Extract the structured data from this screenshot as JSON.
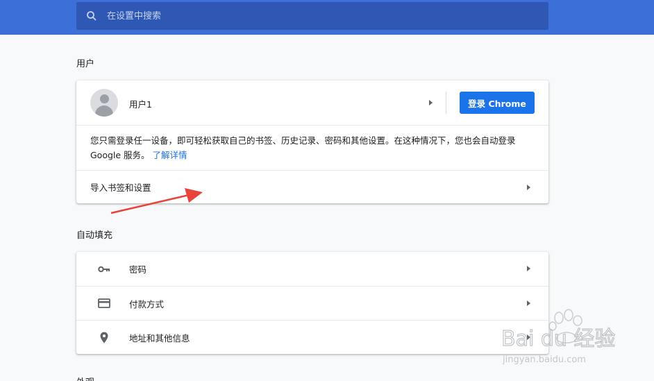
{
  "search": {
    "placeholder": "在设置中搜索"
  },
  "people": {
    "section_title": "用户",
    "user_name": "用户1",
    "signin_label": "登录 Chrome",
    "description": "您只需登录任一设备，即可轻松获取自己的书签、历史记录、密码和其他设置。在这种情况下，您也会自动登录 Google 服务。",
    "learn_more": "了解详情",
    "import_label": "导入书签和设置"
  },
  "autofill": {
    "section_title": "自动填充",
    "items": [
      {
        "label": "密码",
        "icon": "key-icon"
      },
      {
        "label": "付款方式",
        "icon": "credit-card-icon"
      },
      {
        "label": "地址和其他信息",
        "icon": "location-pin-icon"
      }
    ]
  },
  "appearance": {
    "section_title": "外观"
  },
  "watermark": {
    "text_main": "Bai du 经验",
    "text_url": "jingyan.baidu.com"
  },
  "colors": {
    "header": "#3c6fd8",
    "search_bg": "#2f58b5",
    "primary": "#1a73e8",
    "annotation_arrow": "#e8443a"
  }
}
